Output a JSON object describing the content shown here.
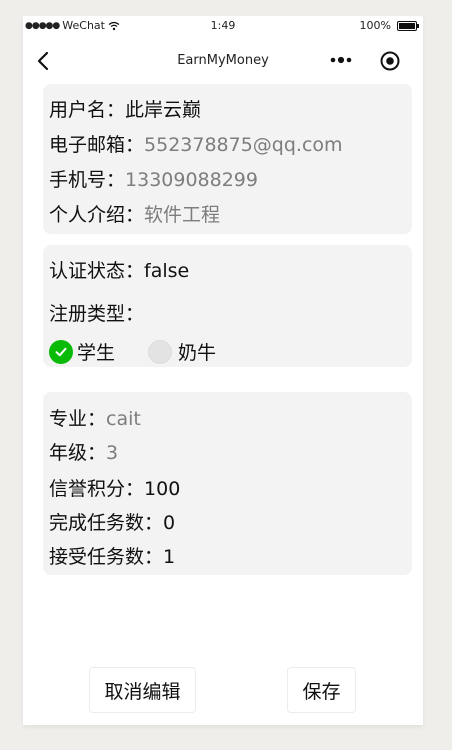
{
  "status_bar": {
    "carrier": "WeChat",
    "time": "1:49",
    "battery": "100%"
  },
  "nav": {
    "title": "EarnMyMoney"
  },
  "profile": {
    "username_label": "用户名：",
    "username_value": "此岸云巅",
    "email_label": "电子邮箱：",
    "email_value": "552378875@qq.com",
    "phone_label": "手机号：",
    "phone_value": "13309088299",
    "intro_label": "个人介绍：",
    "intro_value": "软件工程"
  },
  "registration": {
    "auth_label": "认证状态：",
    "auth_value": "false",
    "type_label": "注册类型：",
    "options": [
      {
        "label": "学生",
        "checked": true
      },
      {
        "label": "奶牛",
        "checked": false
      }
    ]
  },
  "student_info": {
    "major_label": "专业：",
    "major_value": "cait",
    "grade_label": "年级：",
    "grade_value": "3",
    "credit_label": "信誉积分：",
    "credit_value": "100",
    "completed_label": "完成任务数：",
    "completed_value": "0",
    "accepted_label": "接受任务数：",
    "accepted_value": "1"
  },
  "actions": {
    "cancel_label": "取消编辑",
    "save_label": "保存"
  },
  "colors": {
    "accent_green": "#09bb07",
    "card_bg": "#f3f3f3",
    "muted_text": "#7d7d7d"
  }
}
